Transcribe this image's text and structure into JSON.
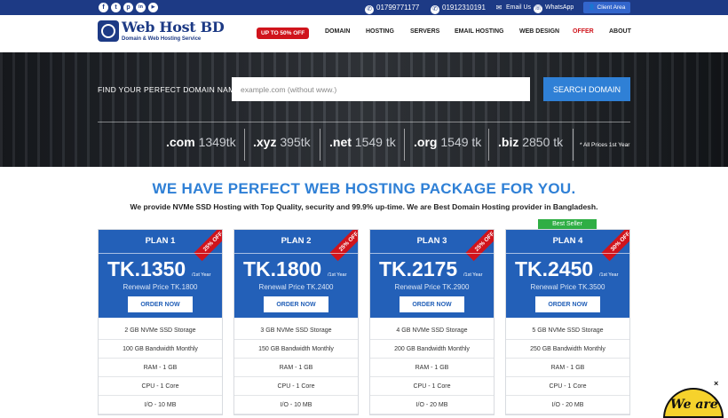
{
  "topbar": {
    "social_icons": [
      {
        "name": "facebook-icon",
        "glyph": "f"
      },
      {
        "name": "twitter-icon",
        "glyph": "t"
      },
      {
        "name": "pinterest-icon",
        "glyph": "p"
      },
      {
        "name": "linkedin-icon",
        "glyph": "in"
      },
      {
        "name": "youtube-icon",
        "glyph": "▶"
      }
    ],
    "phone1": "01799771177",
    "phone2": "01912310191",
    "email_label": "Email Us",
    "whatsapp_label": "WhatsApp",
    "client_area_label": "Client Area"
  },
  "header": {
    "logo_title": "Web Host BD",
    "logo_subtitle": "Domain & Web Hosting Service",
    "offer_badge": "UP TO 50% OFF",
    "nav": [
      "DOMAIN",
      "HOSTING",
      "SERVERS",
      "EMAIL HOSTING",
      "WEB DESIGN",
      "OFFER",
      "ABOUT"
    ]
  },
  "hero": {
    "find_label": "FIND YOUR PERFECT DOMAIN NAME:",
    "input_placeholder": "example.com (without www.)",
    "search_button": "SEARCH DOMAIN",
    "tlds": [
      {
        "ext": ".com",
        "price": "1349tk"
      },
      {
        "ext": ".xyz",
        "price": "395tk"
      },
      {
        "ext": ".net",
        "price": "1549 tk"
      },
      {
        "ext": ".org",
        "price": "1549 tk"
      },
      {
        "ext": ".biz",
        "price": "2850 tk"
      }
    ],
    "note": "* All Prices 1st Year"
  },
  "section": {
    "headline": "WE HAVE PERFECT WEB HOSTING PACKAGE FOR YOU.",
    "subline": "We provide NVMe SSD Hosting with Top Quality, security and 99.9% up-time. We are Best Domain Hosting provider in Bangladesh."
  },
  "best_seller_label": "Best Seller",
  "plans": [
    {
      "name": "PLAN 1",
      "discount": "25% OFF",
      "price": "TK.1350",
      "per": "/1st Year",
      "renewal": "Renewal Price TK.1800",
      "order": "ORDER NOW",
      "features": [
        "2 GB NVMe SSD Storage",
        "100 GB Bandwidth Monthly",
        "RAM - 1 GB",
        "CPU - 1 Core",
        "I/O - 10 MB"
      ]
    },
    {
      "name": "PLAN 2",
      "discount": "25% OFF",
      "price": "TK.1800",
      "per": "/1st Year",
      "renewal": "Renewal Price TK.2400",
      "order": "ORDER NOW",
      "features": [
        "3 GB NVMe SSD Storage",
        "150 GB Bandwidth Monthly",
        "RAM - 1 GB",
        "CPU - 1 Core",
        "I/O - 10 MB"
      ]
    },
    {
      "name": "PLAN 3",
      "discount": "25% OFF",
      "price": "TK.2175",
      "per": "/1st Year",
      "renewal": "Renewal Price TK.2900",
      "order": "ORDER NOW",
      "features": [
        "4 GB NVMe SSD Storage",
        "200 GB Bandwidth Monthly",
        "RAM - 1 GB",
        "CPU - 1 Core",
        "I/O - 20 MB"
      ]
    },
    {
      "name": "PLAN 4",
      "discount": "30% OFF",
      "price": "TK.2450",
      "per": "/1st Year",
      "renewal": "Renewal Price TK.3500",
      "order": "ORDER NOW",
      "features": [
        "5 GB NVMe SSD Storage",
        "250 GB Bandwidth Monthly",
        "RAM - 1 GB",
        "CPU - 1 Core",
        "I/O - 20 MB"
      ]
    }
  ],
  "chat_widget": {
    "text": "We are",
    "close": "×"
  },
  "colors": {
    "brand": "#1d3a85",
    "accent": "#2f80d6",
    "card_head": "#2360b8",
    "offer_red": "#d0141c",
    "best_seller_green": "#2fae44"
  }
}
